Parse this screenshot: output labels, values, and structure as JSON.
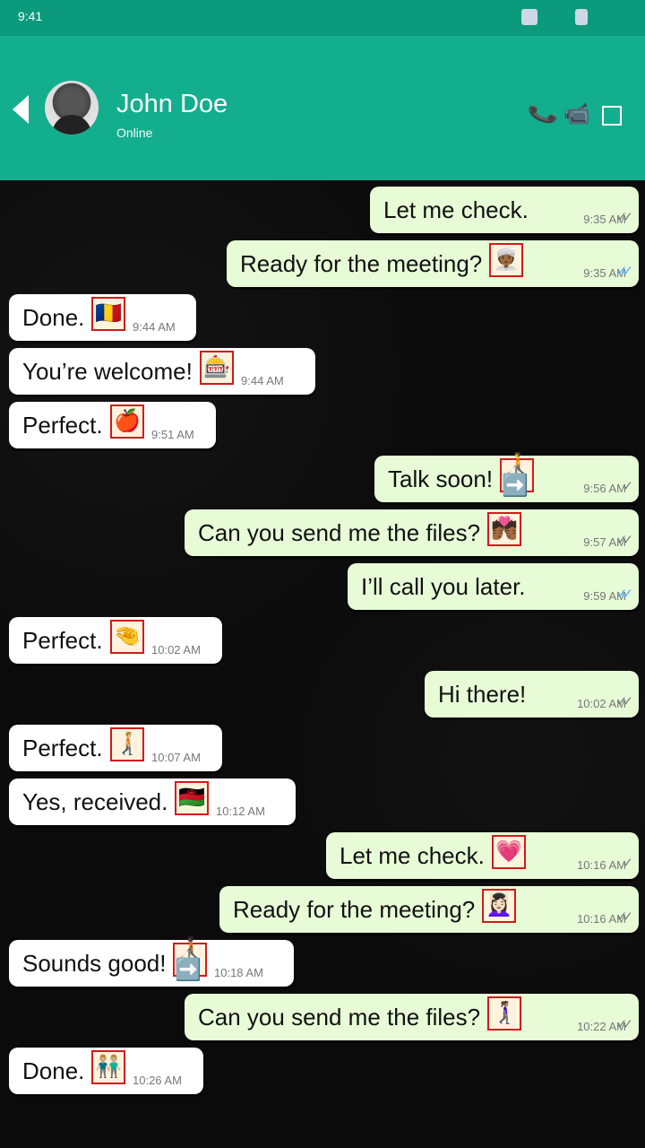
{
  "status_bar": {
    "time": "9:41",
    "icons": [
      "signal-icon",
      "battery-icon"
    ]
  },
  "header": {
    "contact_name": "John Doe",
    "contact_status": "Online",
    "icons": [
      "back-icon",
      "avatar",
      "phone-icon",
      "video-call-icon",
      "menu-icon"
    ]
  },
  "colors": {
    "header": "#13ae8e",
    "status_bar": "#0b9a7c",
    "outgoing_bubble": "#e7fbd7",
    "incoming_bubble": "#ffffff",
    "chat_background": "#0b0b0b"
  },
  "messages": [
    {
      "text": "Let me check.",
      "time": "9:35 AM",
      "direction": "out",
      "emoji": "",
      "tick": "double"
    },
    {
      "text": "Ready for the meeting?",
      "time": "9:35 AM",
      "direction": "out",
      "emoji": "👳🏾‍♀️",
      "tick": "read"
    },
    {
      "text": "Done.",
      "time": "9:44 AM",
      "direction": "in",
      "emoji": "🇷🇴",
      "tick": ""
    },
    {
      "text": "You’re welcome!",
      "time": "9:44 AM",
      "direction": "in",
      "emoji": "🎰",
      "tick": ""
    },
    {
      "text": "Perfect.",
      "time": "9:51 AM",
      "direction": "in",
      "emoji": "🍎",
      "tick": ""
    },
    {
      "text": "Talk soon!",
      "time": "9:56 AM",
      "direction": "out",
      "emoji": "🧑‍🦯➡️",
      "tick": "single"
    },
    {
      "text": "Can you send me the files?",
      "time": "9:57 AM",
      "direction": "out",
      "emoji": "💏🏾",
      "tick": "double"
    },
    {
      "text": "I’ll call you later.",
      "time": "9:59 AM",
      "direction": "out",
      "emoji": "",
      "tick": "read"
    },
    {
      "text": "Perfect.",
      "time": "10:02 AM",
      "direction": "in",
      "emoji": "🤏",
      "tick": ""
    },
    {
      "text": "Hi there!",
      "time": "10:02 AM",
      "direction": "out",
      "emoji": "",
      "tick": "double"
    },
    {
      "text": "Perfect.",
      "time": "10:07 AM",
      "direction": "in",
      "emoji": "🚶🏼‍➡️",
      "tick": ""
    },
    {
      "text": "Yes, received.",
      "time": "10:12 AM",
      "direction": "in",
      "emoji": "🇲🇼",
      "tick": ""
    },
    {
      "text": "Let me check.",
      "time": "10:16 AM",
      "direction": "out",
      "emoji": "💗",
      "tick": "single"
    },
    {
      "text": "Ready for the meeting?",
      "time": "10:16 AM",
      "direction": "out",
      "emoji": "💆🏻‍♀️",
      "tick": "double"
    },
    {
      "text": "Sounds good!",
      "time": "10:18 AM",
      "direction": "in",
      "emoji": "🧑🏿‍🦯➡️",
      "tick": ""
    },
    {
      "text": "Can you send me the files?",
      "time": "10:22 AM",
      "direction": "out",
      "emoji": "🚶🏽‍♀️‍➡️",
      "tick": "double"
    },
    {
      "text": "Done.",
      "time": "10:26 AM",
      "direction": "in",
      "emoji": "👬🏼",
      "tick": ""
    }
  ]
}
